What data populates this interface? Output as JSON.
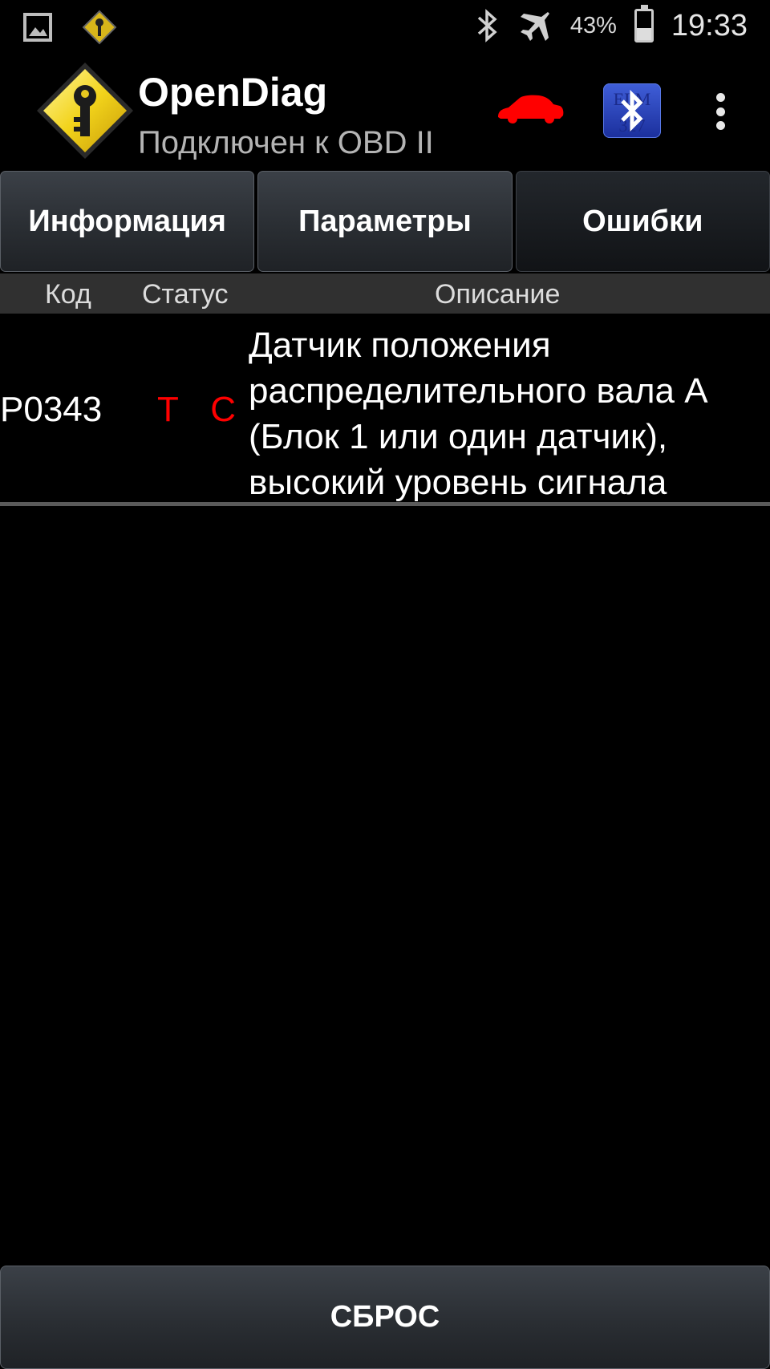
{
  "status_bar": {
    "icons": [
      "gallery-icon",
      "opendiag-notification-icon",
      "bluetooth-icon",
      "airplane-icon"
    ],
    "battery_percent": "43%",
    "battery_level": 0.43,
    "time": "19:33"
  },
  "app": {
    "title": "OpenDiag",
    "subtitle": "Подключен к OBD II",
    "car_color": "#ff0000",
    "bluetooth_badge_text": "ELM 327"
  },
  "tabs": [
    {
      "label": "Информация",
      "active": false
    },
    {
      "label": "Параметры",
      "active": false
    },
    {
      "label": "Ошибки",
      "active": true
    }
  ],
  "table": {
    "headers": {
      "code": "Код",
      "status": "Статус",
      "description": "Описание"
    },
    "rows": [
      {
        "code": "P0343",
        "status": "T C",
        "description": "Датчик положения распределительного вала A (Блок 1 или один датчик), высокий уровень сигнала"
      }
    ]
  },
  "reset_button": "СБРОС",
  "colors": {
    "status_red": "#ff0000",
    "background": "#000000",
    "header_bg": "#303030"
  }
}
